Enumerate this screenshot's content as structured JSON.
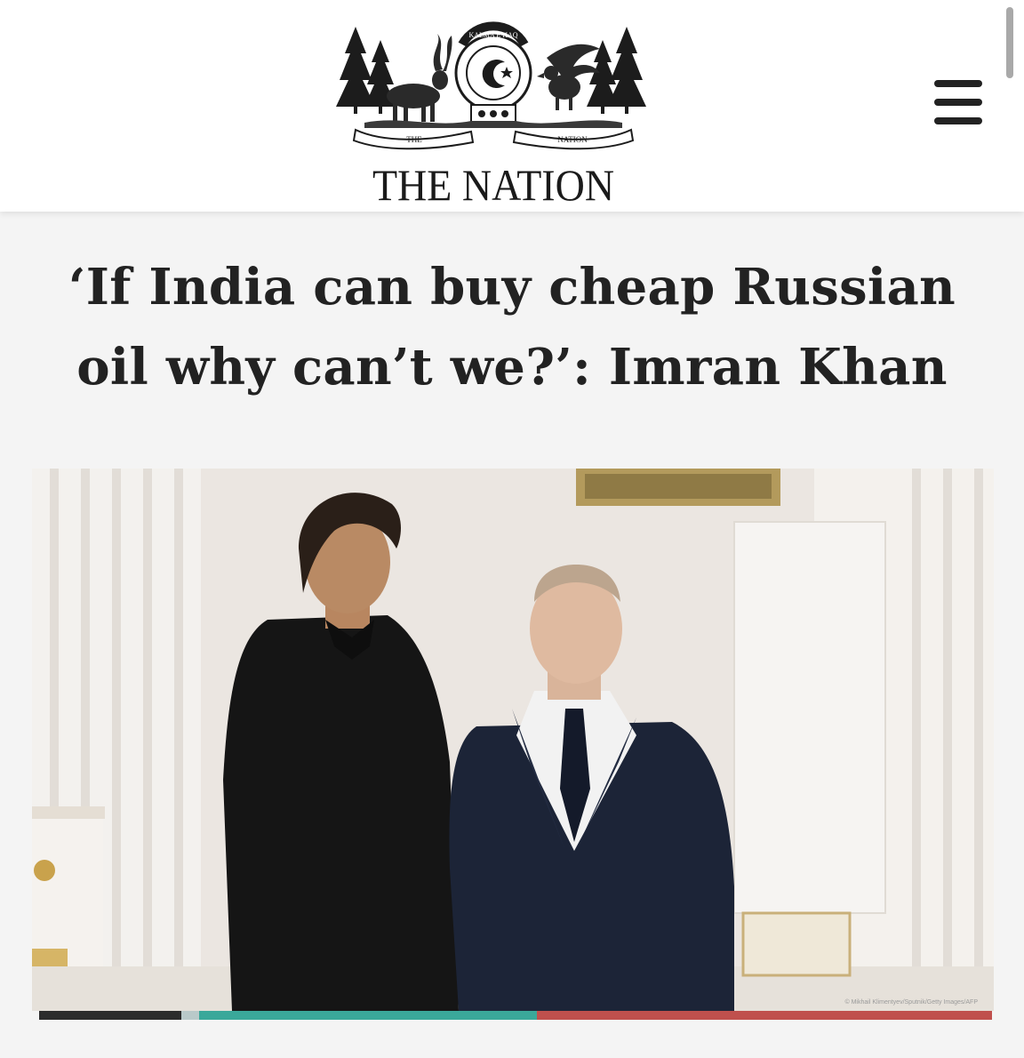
{
  "header": {
    "logo": {
      "emblem_banner_top": "KALMA E HAQ",
      "emblem_banner_left": "THE",
      "emblem_banner_right": "NATION",
      "wordmark": "THE NATION"
    },
    "menu_icon": "hamburger-menu-icon"
  },
  "article": {
    "headline": "‘If India can buy cheap Russian oil why can’t we?’: Imran Khan",
    "photo": {
      "credit": "© Mikhail Klimentyev/Sputnik/Getty Images/AFP"
    }
  },
  "colors": {
    "header_bg": "#ffffff",
    "page_bg": "#f4f4f4",
    "text": "#222222",
    "strip_teal": "#3aa89a",
    "strip_red": "#c0504d",
    "strip_dark": "#2c2c2c"
  }
}
